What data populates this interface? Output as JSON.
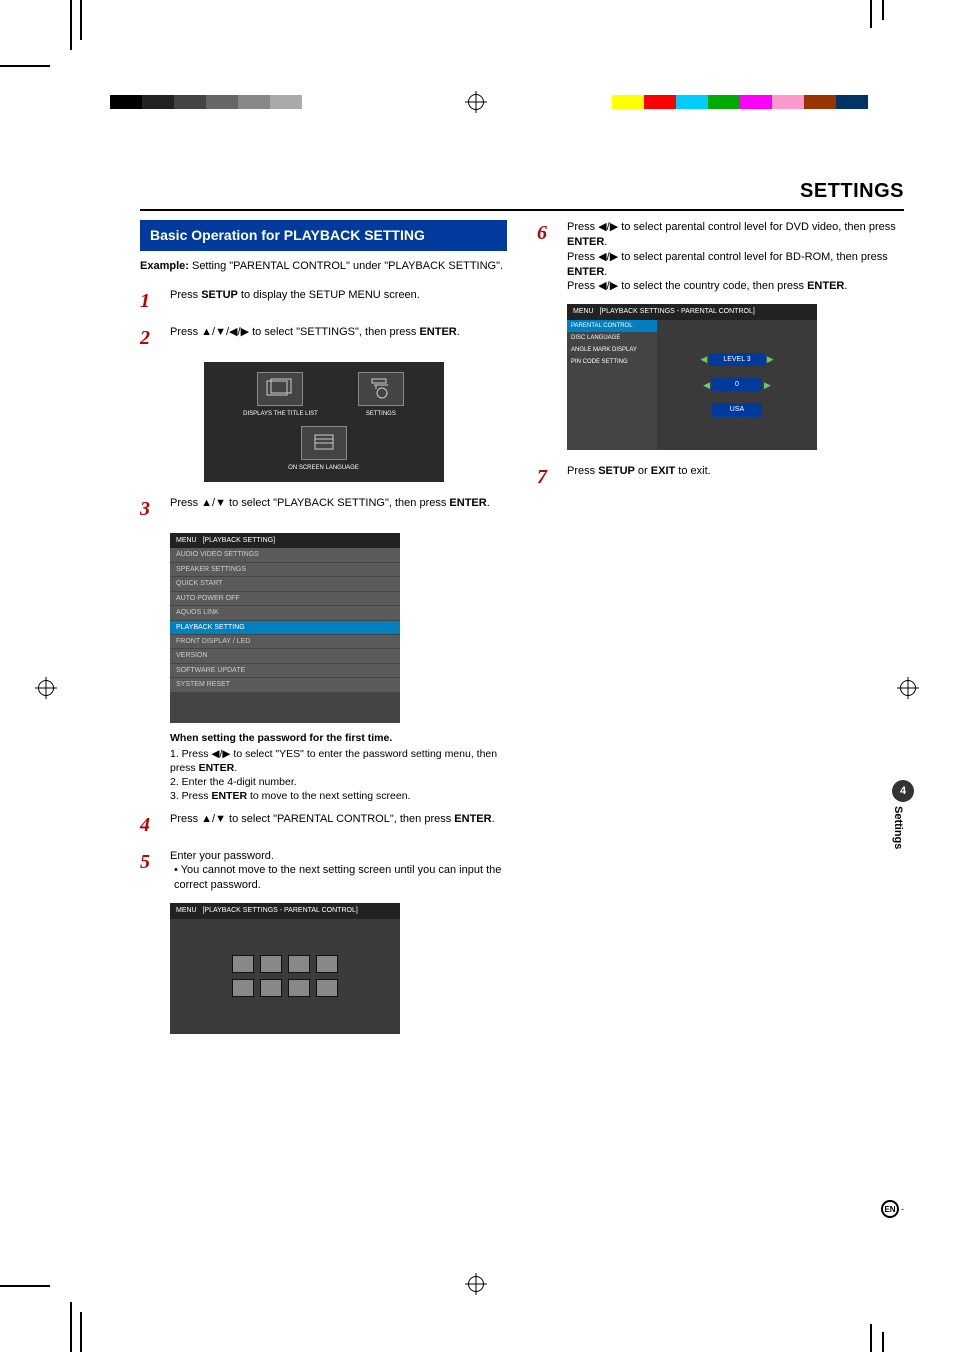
{
  "page": {
    "title": "SETTINGS",
    "lang_marker": "EN",
    "lang_dash": "-"
  },
  "side_tab": {
    "num": "4",
    "label": "Settings"
  },
  "section": {
    "heading": "Basic Operation for PLAYBACK SETTING",
    "example_prefix": "Example:",
    "example_text": " Setting \"PARENTAL CONTROL\" under \"PLAYBACK SETTING\"."
  },
  "steps": {
    "s1": {
      "num": "1",
      "pre": "Press ",
      "b1": "SETUP",
      "post": " to display the SETUP MENU screen."
    },
    "s2": {
      "num": "2",
      "pre": "Press ▲/▼/◀/▶ to select \"SETTINGS\", then press ",
      "b1": "ENTER",
      "post": "."
    },
    "s3": {
      "num": "3",
      "pre": "Press ▲/▼ to select \"PLAYBACK SETTING\", then press ",
      "b1": "ENTER",
      "post": "."
    },
    "s4": {
      "num": "4",
      "pre": "Press ▲/▼ to select \"PARENTAL CONTROL\", then press ",
      "b1": "ENTER",
      "post": "."
    },
    "s5": {
      "num": "5",
      "line": "Enter your password.",
      "bullet": "You cannot move to the next setting screen until you can input the correct password."
    },
    "s6": {
      "num": "6",
      "l1a": "Press ◀/▶ to select parental control level for DVD video, then press ",
      "l1b": "ENTER",
      "l1c": ".",
      "l2a": "Press ◀/▶ to select parental control level for BD-ROM, then press ",
      "l2b": "ENTER",
      "l2c": ".",
      "l3a": "Press ◀/▶ to select the country code, then press ",
      "l3b": "ENTER",
      "l3c": "."
    },
    "s7": {
      "num": "7",
      "pre": "Press ",
      "b1": "SETUP",
      "mid": " or ",
      "b2": "EXIT",
      "post": " to exit."
    }
  },
  "substeps": {
    "title": "When setting the password for the first time.",
    "l1a": "1. Press ◀/▶ to select \"YES\" to enter the password setting menu, then press ",
    "l1b": "ENTER",
    "l1c": ".",
    "l2": "2. Enter the 4-digit number.",
    "l3a": "3. Press ",
    "l3b": "ENTER",
    "l3c": " to move to the next setting screen."
  },
  "tile_menu": {
    "t1": "DISPLAYS THE TITLE LIST",
    "t2": "SETTINGS",
    "t3": "ON SCREEN LANGUAGE"
  },
  "settings_list": {
    "header_menu": "MENU",
    "header_path": "[PLAYBACK SETTING]",
    "items": [
      "AUDIO VIDEO SETTINGS",
      "SPEAKER SETTINGS",
      "QUICK START",
      "AUTO POWER OFF",
      "AQUOS LINK",
      "PLAYBACK SETTING",
      "FRONT DISPLAY / LED",
      "VERSION",
      "SOFTWARE UPDATE",
      "SYSTEM RESET"
    ],
    "highlight_index": 5
  },
  "pwd_panel": {
    "header_menu": "MENU",
    "header_path": "[PLAYBACK SETTINGS - PARENTAL CONTROL]"
  },
  "pc_panel": {
    "header_menu": "MENU",
    "header_path": "[PLAYBACK SETTINGS - PARENTAL CONTROL]",
    "left": [
      "PARENTAL CONTROL",
      "DISC LANGUAGE",
      "ANGLE MARK DISPLAY",
      "PIN CODE SETTING"
    ],
    "val1": "LEVEL 3",
    "val2": "0",
    "val3": "USA"
  }
}
